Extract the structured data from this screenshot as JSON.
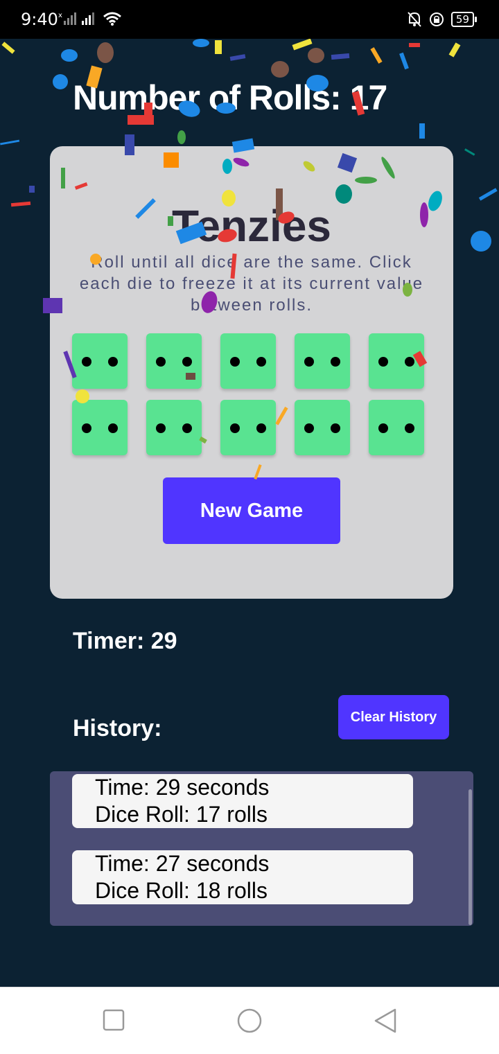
{
  "status": {
    "time": "9:40",
    "battery": "59"
  },
  "game": {
    "rolls_text": "Number of Rolls: 17",
    "title": "Tenzies",
    "description": "Roll until all dice are the same. Click each die to freeze it at its current value between rolls.",
    "dice_values": [
      2,
      2,
      2,
      2,
      2,
      2,
      2,
      2,
      2,
      2
    ],
    "die_color": "#59e391",
    "new_game_label": "New Game",
    "timer_text": "Timer: 29"
  },
  "history": {
    "label": "History:",
    "clear_label": "Clear History",
    "entries": [
      {
        "time": "Time: 29 seconds",
        "rolls": "Dice Roll: 17 rolls"
      },
      {
        "time": "Time: 27 seconds",
        "rolls": "Dice Roll: 18 rolls"
      }
    ]
  },
  "colors": {
    "background": "#0c2233",
    "card": "#d4d4d6",
    "accent": "#5035ff",
    "history_panel": "#4b4d75"
  },
  "nav": {
    "icons": [
      "recent-apps-icon",
      "home-icon",
      "back-icon"
    ]
  }
}
